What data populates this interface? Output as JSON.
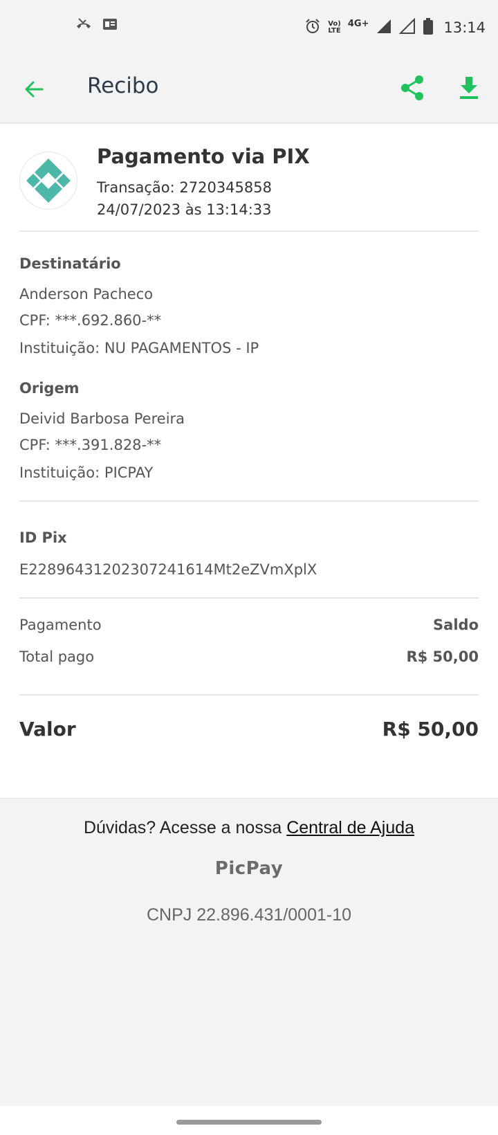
{
  "status_bar": {
    "time": "13:14",
    "network_top": "Vo)",
    "network_bottom": "LTE",
    "signal_type": "4G+",
    "icons": [
      "missed-call-icon",
      "message-icon",
      "alarm-icon",
      "signal-icon",
      "signal-empty-icon",
      "battery-icon"
    ]
  },
  "app_bar": {
    "title": "Recibo",
    "back_icon": "arrow-left-icon",
    "share_icon": "share-icon",
    "download_icon": "download-icon"
  },
  "header": {
    "title": "Pagamento via PIX",
    "transaction": "Transação: 2720345858",
    "datetime": "24/07/2023 às 13:14:33"
  },
  "recipient": {
    "label": "Destinatário",
    "name": "Anderson Pacheco",
    "cpf": "CPF: ***.692.860-**",
    "institution": "Instituição: NU PAGAMENTOS - IP"
  },
  "origin": {
    "label": "Origem",
    "name": "Deivid Barbosa Pereira",
    "cpf": "CPF: ***.391.828-**",
    "institution": "Instituição: PICPAY"
  },
  "pix_id": {
    "label": "ID Pix",
    "value": "E22896431202307241614Mt2eZVmXplX"
  },
  "payment": {
    "method_label": "Pagamento",
    "method_value": "Saldo",
    "total_label": "Total pago",
    "total_value": "R$ 50,00"
  },
  "amount": {
    "label": "Valor",
    "value": "R$ 50,00"
  },
  "footer": {
    "help_prefix": "Dúvidas? Acesse a nossa ",
    "help_link": "Central de Ajuda",
    "brand": "PicPay",
    "cnpj": "CNPJ 22.896.431/0001-10"
  },
  "colors": {
    "accent": "#21c25e",
    "pix_logo": "#4bb8a9"
  }
}
